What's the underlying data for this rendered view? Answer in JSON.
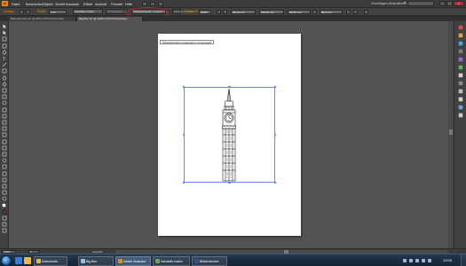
{
  "app": {
    "logo_text": "Ai"
  },
  "menubar": {
    "items": [
      "Datei",
      "Bearbeiten",
      "Objekt",
      "Schrift",
      "Auswahl",
      "Effekt",
      "Ansicht",
      "Fenster",
      "Hilfe"
    ],
    "workspace_label": "Grundlagen-Illustrationen"
  },
  "controlbar": {
    "selection_label": "Gruppe",
    "outline_label": "Kontur",
    "outline_value": "1 Pt.",
    "image_trace_button": "Interaktiv malen",
    "expand_button": "Umwandeln",
    "trace_options_button": "Objektauswahl: Umwandeln",
    "live_trace_button": "Interaktiv malen",
    "opacity_label": "Deckkraft",
    "opacity_value": "100%",
    "x_value": "95,49 mm",
    "y_value": "105,81 mm",
    "w_value": "84,85 mm",
    "h_value": "88,4 mm"
  },
  "document_tabs": [
    {
      "label": "Bildrecherche.ai* @ 66% (CMYK/Vorschau)",
      "active": false
    },
    {
      "label": "Big-Ben.ai* @ 100% (CMYK/Vorschau)",
      "active": true
    }
  ],
  "tooltip": {
    "text": "Objektauswahl umwandeln in Liniengrafik"
  },
  "statusbar": {
    "zoom_value": "100%",
    "page_value": "1",
    "status_text": "Auswahl"
  },
  "taskbar": {
    "items": [
      {
        "label": "Dokumente"
      },
      {
        "label": "Big Ben"
      },
      {
        "label": "Adobe Illustrator"
      },
      {
        "label": "Interaktiv malen"
      },
      {
        "label": "Bildrecherche"
      }
    ],
    "clock": "13:09"
  },
  "colors": {
    "accent": "#f08a00",
    "selection": "#5a8ee8",
    "highlight": "#d11a1a"
  },
  "icons": {
    "tools": [
      "selection-tool-icon",
      "direct-selection-tool-icon",
      "magic-wand-icon",
      "lasso-icon",
      "pen-icon",
      "type-icon",
      "line-icon",
      "rectangle-icon",
      "paintbrush-icon",
      "pencil-icon",
      "blob-brush-icon",
      "eraser-icon",
      "rotate-icon",
      "scale-icon",
      "warp-icon",
      "free-transform-icon",
      "shape-builder-icon",
      "perspective-grid-icon",
      "mesh-icon",
      "gradient-icon",
      "eyedropper-icon",
      "blend-icon",
      "symbol-sprayer-icon",
      "column-graph-icon",
      "artboard-icon",
      "slice-icon",
      "hand-icon",
      "zoom-icon",
      "fill-color-icon",
      "stroke-color-icon",
      "swap-icon",
      "drawing-mode-icon",
      "screen-mode-icon"
    ],
    "dock": [
      "color-panel-icon",
      "color-guide-icon",
      "swatches-icon",
      "brushes-icon",
      "symbols-icon",
      "graphic-styles-icon",
      "stroke-panel-icon",
      "gradient-panel-icon",
      "transparency-panel-icon",
      "appearance-panel-icon",
      "layers-panel-icon",
      "artboards-panel-icon"
    ]
  }
}
